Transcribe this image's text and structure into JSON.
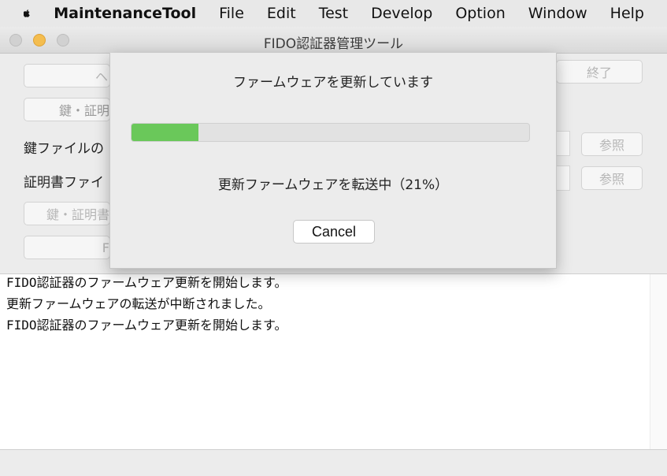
{
  "menubar": {
    "apple_icon": "apple-logo-icon",
    "app_name": "MaintenanceTool",
    "items": [
      "File",
      "Edit",
      "Test",
      "Develop",
      "Option",
      "Window",
      "Help"
    ]
  },
  "window": {
    "title": "FIDO認証器管理ツール"
  },
  "background": {
    "top_button_partial": "ヘ",
    "quit_button": "終了",
    "key_cert_button_partial": "鍵・証明",
    "key_file_label_partial": "鍵ファイルの",
    "cert_file_label_partial": "証明書ファイ",
    "browse_button_1": "参照",
    "browse_button_2": "参照",
    "key_cert_button2_partial": "鍵・証明書",
    "bottom_button_partial": "F"
  },
  "log": {
    "lines": [
      "FIDO認証器のファームウェア更新を開始します。",
      "更新ファームウェアの転送が中断されました。",
      "FIDO認証器のファームウェア更新を開始します。"
    ]
  },
  "dialog": {
    "title": "ファームウェアを更新しています",
    "progress_percent": 21,
    "status": "更新ファームウェアを転送中（21%）",
    "cancel_label": "Cancel"
  },
  "colors": {
    "progress_fill": "#6ac85a",
    "minimize_button": "#f4bd4f"
  }
}
